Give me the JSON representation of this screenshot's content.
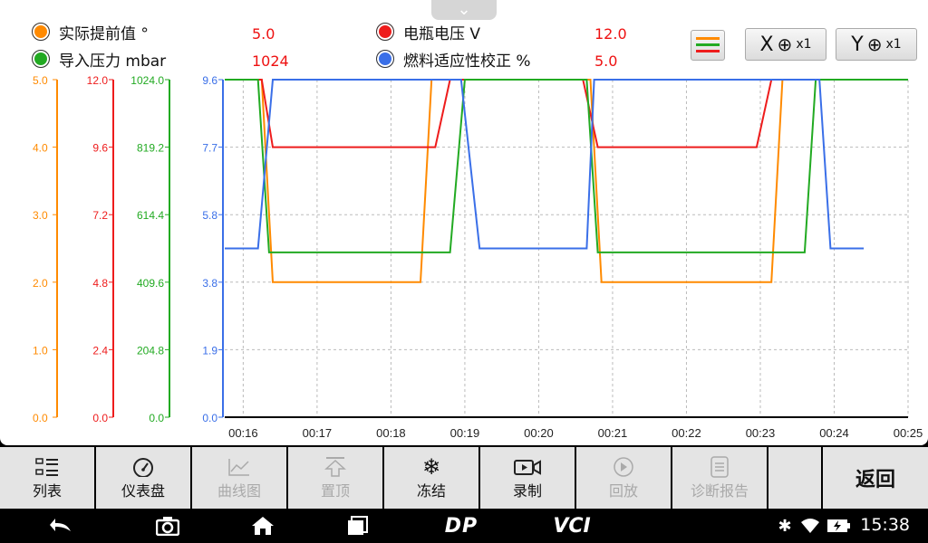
{
  "legend": {
    "items": [
      {
        "label": "实际提前值 °",
        "value": "5.0",
        "color": "#ff8a00"
      },
      {
        "label": "导入压力 mbar",
        "value": "1024",
        "color": "#22aa22"
      },
      {
        "label": "电瓶电压 V",
        "value": "12.0",
        "color": "#ee1c1c"
      },
      {
        "label": "燃料适应性校正 %",
        "value": "5.0",
        "color": "#3a6fe8"
      }
    ],
    "value_color": "#ee1111"
  },
  "tools": {
    "x_zoom": {
      "axis": "X",
      "factor": "x1"
    },
    "y_zoom": {
      "axis": "Y",
      "factor": "x1"
    }
  },
  "chart_data": {
    "type": "line",
    "x": [
      "00:16",
      "00:17",
      "00:18",
      "00:19",
      "00:20",
      "00:21",
      "00:22",
      "00:23",
      "00:24",
      "00:25"
    ],
    "axes": [
      {
        "color": "#ff8a00",
        "ticks": [
          "5.0",
          "4.0",
          "3.0",
          "2.0",
          "1.0",
          "0.0"
        ],
        "range": [
          0,
          5
        ]
      },
      {
        "color": "#ee1c1c",
        "ticks": [
          "12.0",
          "9.6",
          "7.2",
          "4.8",
          "2.4",
          "0.0"
        ],
        "range": [
          0,
          12
        ]
      },
      {
        "color": "#22aa22",
        "ticks": [
          "1024.0",
          "819.2",
          "614.4",
          "409.6",
          "204.8",
          "0.0"
        ],
        "range": [
          0,
          1024
        ]
      },
      {
        "color": "#3a6fe8",
        "ticks": [
          "9.6",
          "7.7",
          "5.8",
          "3.8",
          "1.9",
          "0.0"
        ],
        "range": [
          0,
          9.6
        ]
      }
    ],
    "series": [
      {
        "axis": 0,
        "color": "#ff8a00",
        "points": [
          [
            15.75,
            5.0
          ],
          [
            16.25,
            5.0
          ],
          [
            16.4,
            2.0
          ],
          [
            17.7,
            2.0
          ],
          [
            18.4,
            2.0
          ],
          [
            18.55,
            5.0
          ],
          [
            20.7,
            5.0
          ],
          [
            20.85,
            2.0
          ],
          [
            23.15,
            2.0
          ],
          [
            23.3,
            5.0
          ],
          [
            25.0,
            5.0
          ]
        ]
      },
      {
        "axis": 1,
        "color": "#ee1c1c",
        "points": [
          [
            15.75,
            12.0
          ],
          [
            16.25,
            12.0
          ],
          [
            16.4,
            9.6
          ],
          [
            18.6,
            9.6
          ],
          [
            18.8,
            12.0
          ],
          [
            20.6,
            12.0
          ],
          [
            20.8,
            9.6
          ],
          [
            22.95,
            9.6
          ],
          [
            23.15,
            12.0
          ],
          [
            25.0,
            12.0
          ]
        ]
      },
      {
        "axis": 2,
        "color": "#22aa22",
        "points": [
          [
            15.75,
            1024
          ],
          [
            16.2,
            1024
          ],
          [
            16.35,
            500
          ],
          [
            18.8,
            500
          ],
          [
            19.0,
            1024
          ],
          [
            20.65,
            1024
          ],
          [
            20.8,
            500
          ],
          [
            23.6,
            500
          ],
          [
            23.75,
            1024
          ],
          [
            25.0,
            1024
          ]
        ]
      },
      {
        "axis": 3,
        "color": "#3a6fe8",
        "points": [
          [
            15.75,
            4.8
          ],
          [
            16.2,
            4.8
          ],
          [
            16.4,
            9.6
          ],
          [
            18.95,
            9.6
          ],
          [
            19.2,
            4.8
          ],
          [
            20.65,
            4.8
          ],
          [
            20.75,
            9.6
          ],
          [
            23.8,
            9.6
          ],
          [
            23.95,
            4.8
          ],
          [
            24.4,
            4.8
          ]
        ]
      }
    ],
    "xrange": [
      15.75,
      25.0
    ],
    "grid": true
  },
  "toolbar": {
    "list": "列表",
    "dashboard": "仪表盘",
    "curve": "曲线图",
    "pin_top": "置顶",
    "freeze": "冻结",
    "record": "录制",
    "playback": "回放",
    "report": "诊断报告",
    "back": "返回"
  },
  "navbar": {
    "dp_logo": "DP",
    "vci_logo": "VCI",
    "time": "15:38"
  }
}
